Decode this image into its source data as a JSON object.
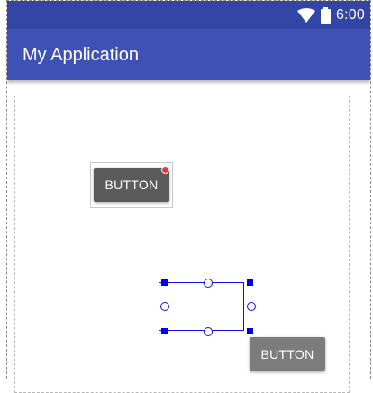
{
  "status_bar": {
    "time": "6:00",
    "icons": [
      "wifi-icon",
      "battery-icon"
    ],
    "color": "#3345a5"
  },
  "app_bar": {
    "title": "My Application",
    "color": "#3f51b5"
  },
  "canvas": {
    "buttons": [
      {
        "label": "BUTTON",
        "state": "error"
      },
      {
        "label": "BUTTON",
        "state": "normal"
      }
    ],
    "selection_color": "#0000ee"
  }
}
